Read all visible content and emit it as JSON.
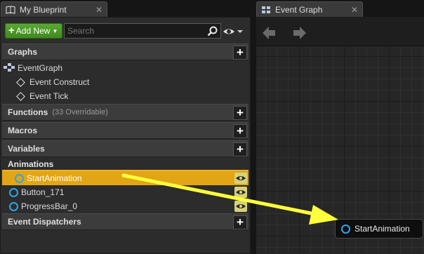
{
  "blueprint_tab": {
    "title": "My Blueprint",
    "close": "✕"
  },
  "graph_tab": {
    "title": "Event Graph",
    "close": "✕"
  },
  "toolbar": {
    "add_new_label": "Add New",
    "search_placeholder": "Search"
  },
  "sections": {
    "graphs": "Graphs",
    "functions": "Functions",
    "functions_sub": "(33 Overridable)",
    "macros": "Macros",
    "variables": "Variables",
    "event_dispatchers": "Event Dispatchers"
  },
  "graphs": {
    "event_graph": "EventGraph",
    "items": [
      "Event Construct",
      "Event Tick"
    ]
  },
  "variables": {
    "category": "Animations",
    "items": [
      "StartAnimation",
      "Button_171",
      "ProgressBar_0"
    ],
    "selected_index": 0
  },
  "graph_node": {
    "label": "StartAnimation"
  },
  "colors": {
    "selected_row": "#e2a516",
    "variable_pin": "#2ea6e6",
    "add_new": "#4c9a29",
    "annotation_arrow": "#ffff3c"
  },
  "icons": {
    "blueprint_tab": "book-icon",
    "graph_tab": "graph-icon",
    "search": "search-icon",
    "visibility": "eye-icon",
    "back": "arrow-left-icon",
    "forward": "arrow-right-icon"
  }
}
